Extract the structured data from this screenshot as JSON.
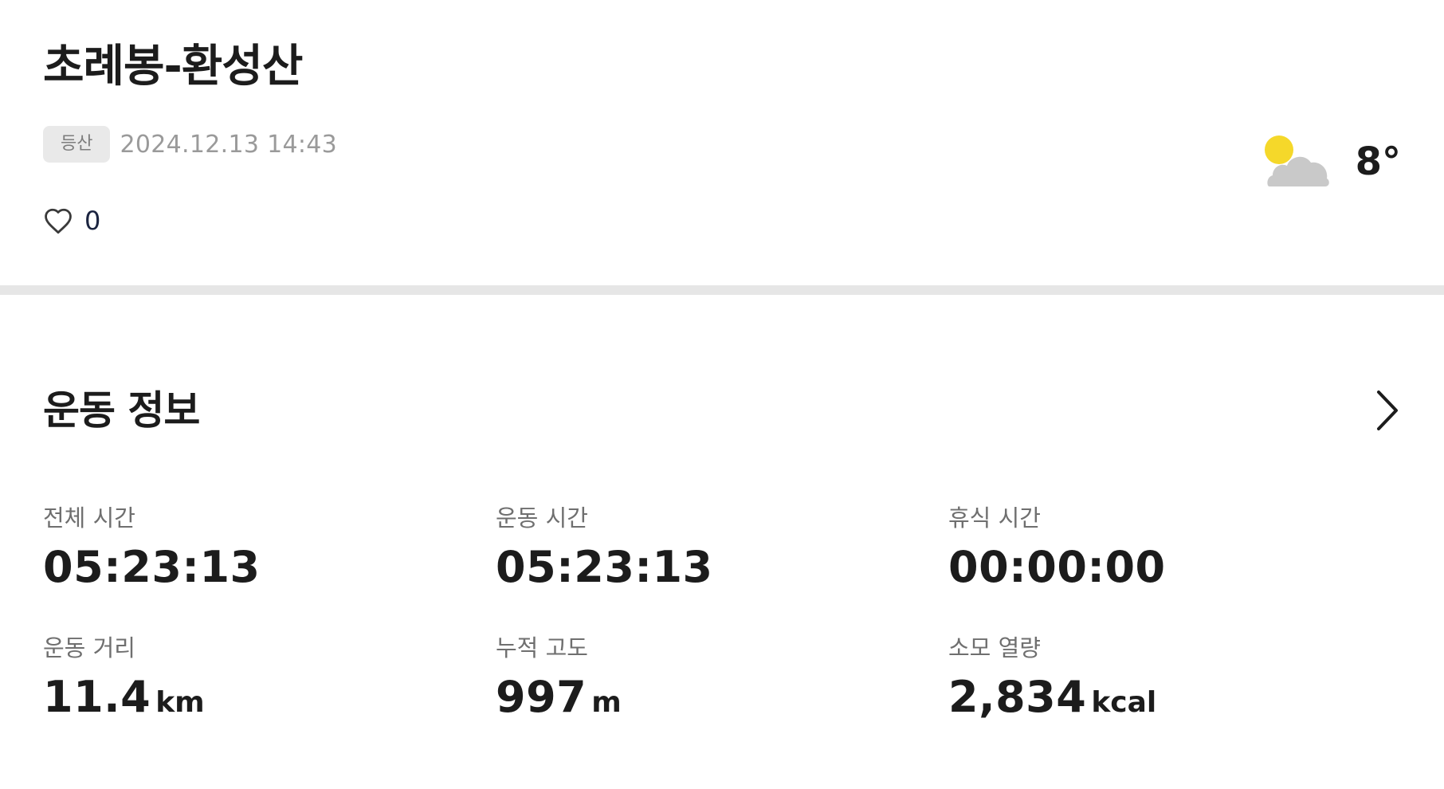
{
  "activity": {
    "title": "초례봉-환성산",
    "category": "등산",
    "date": "2024.12.13 14:43",
    "likes": "0"
  },
  "weather": {
    "icon": "partly-cloudy-icon",
    "temperature": "8°",
    "sun_color": "#f5d82a",
    "cloud_color": "#c9c9c9"
  },
  "section": {
    "title": "운동 정보"
  },
  "stats": [
    {
      "label": "전체 시간",
      "value": "05:23:13",
      "unit": ""
    },
    {
      "label": "운동 시간",
      "value": "05:23:13",
      "unit": ""
    },
    {
      "label": "휴식 시간",
      "value": "00:00:00",
      "unit": ""
    },
    {
      "label": "운동 거리",
      "value": "11.4",
      "unit": "km"
    },
    {
      "label": "누적 고도",
      "value": "997",
      "unit": "m"
    },
    {
      "label": "소모 열량",
      "value": "2,834",
      "unit": "kcal"
    }
  ],
  "colors": {
    "divider": "#e6e6e6",
    "badge_bg": "#e9e9e9",
    "text_primary": "#1c1c1c",
    "text_secondary": "#6f6f6f"
  }
}
